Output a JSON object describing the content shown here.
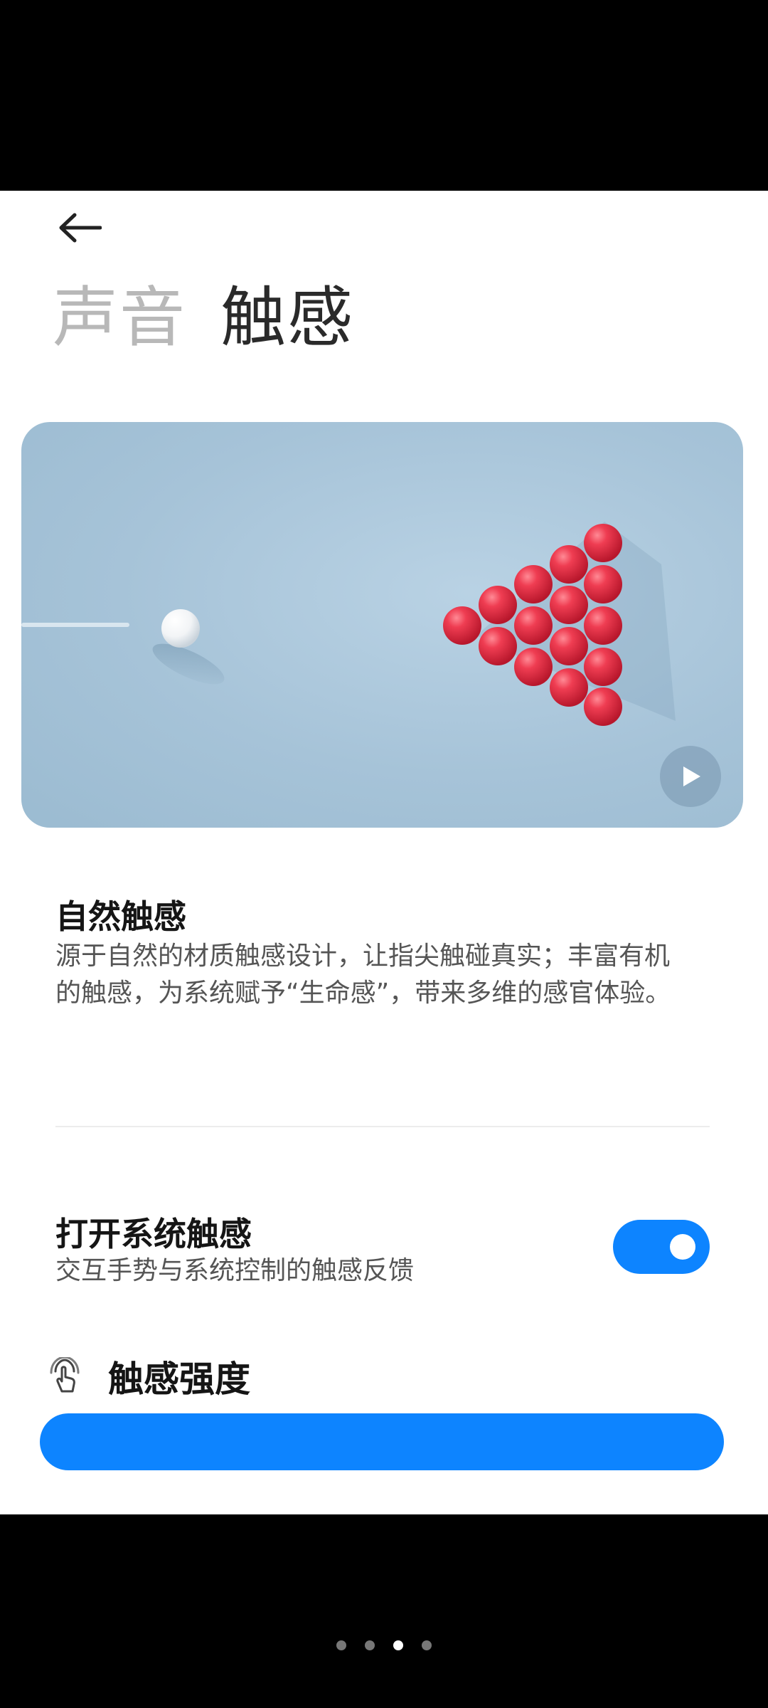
{
  "header": {
    "tabs": [
      {
        "label": "声音",
        "active": false
      },
      {
        "label": "触感",
        "active": true
      }
    ]
  },
  "feature": {
    "title": "自然触感",
    "description": "源于自然的材质触感设计，让指尖触碰真实；丰富有机的触感，为系统赋予“生命感”，带来多维的感官体验。"
  },
  "system_haptics": {
    "title": "打开系统触感",
    "subtitle": "交互手势与系统控制的触感反馈",
    "enabled": true
  },
  "strength": {
    "label": "触感强度",
    "icon": "touch-icon"
  },
  "pager": {
    "count": 4,
    "active_index": 2
  },
  "colors": {
    "accent": "#0d84ff",
    "ball": "#e8354a",
    "hero_bg": "#a6c3d8"
  },
  "icons": {
    "back": "back-arrow-icon",
    "play": "play-icon"
  }
}
